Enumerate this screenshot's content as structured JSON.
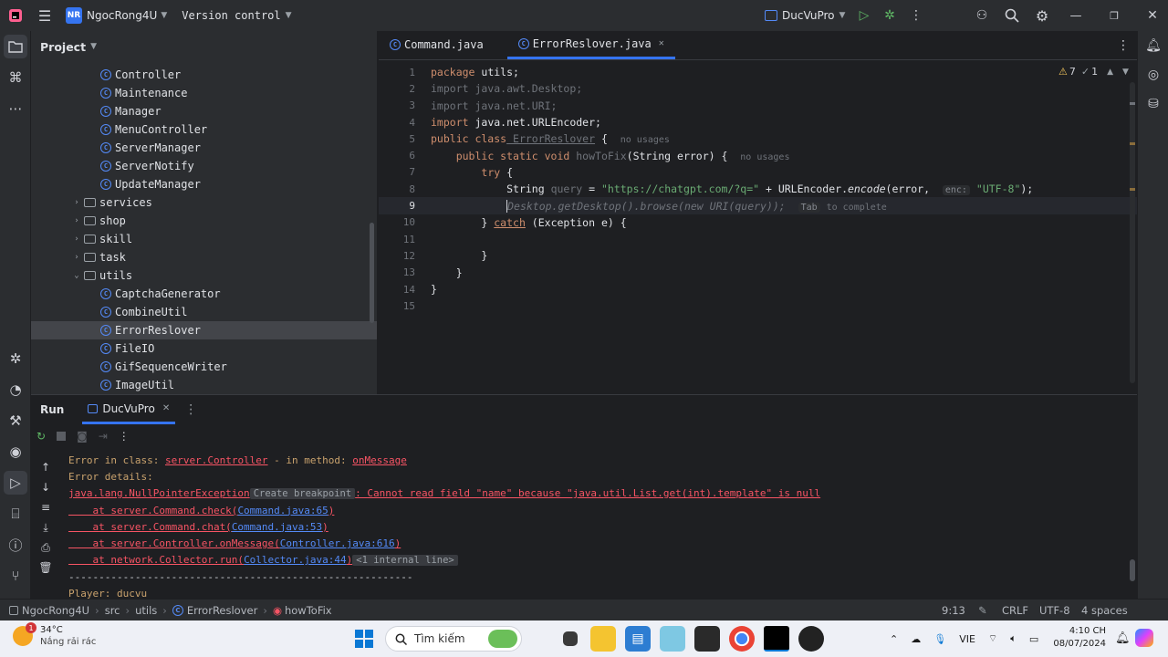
{
  "titlebar": {
    "project_badge": "NR",
    "project_name": "NgocRong4U",
    "vcs_label": "Version control",
    "run_config": "DucVuPro"
  },
  "project_panel": {
    "title": "Project",
    "items": [
      {
        "label": "Controller",
        "type": "class",
        "indent": 2
      },
      {
        "label": "Maintenance",
        "type": "class",
        "indent": 2
      },
      {
        "label": "Manager",
        "type": "class",
        "indent": 2
      },
      {
        "label": "MenuController",
        "type": "class",
        "indent": 2
      },
      {
        "label": "ServerManager",
        "type": "class",
        "indent": 2
      },
      {
        "label": "ServerNotify",
        "type": "class",
        "indent": 2
      },
      {
        "label": "UpdateManager",
        "type": "class",
        "indent": 2
      },
      {
        "label": "services",
        "type": "folder",
        "indent": 1
      },
      {
        "label": "shop",
        "type": "folder",
        "indent": 1
      },
      {
        "label": "skill",
        "type": "folder",
        "indent": 1
      },
      {
        "label": "task",
        "type": "folder",
        "indent": 1
      },
      {
        "label": "utils",
        "type": "folder-open",
        "indent": 1
      },
      {
        "label": "CaptchaGenerator",
        "type": "class",
        "indent": 2
      },
      {
        "label": "CombineUtil",
        "type": "class",
        "indent": 2
      },
      {
        "label": "ErrorReslover",
        "type": "class",
        "indent": 2,
        "selected": true
      },
      {
        "label": "FileIO",
        "type": "class",
        "indent": 2
      },
      {
        "label": "GifSequenceWriter",
        "type": "class",
        "indent": 2
      },
      {
        "label": "ImageUtil",
        "type": "class",
        "indent": 2
      }
    ]
  },
  "editor": {
    "tabs": [
      {
        "label": "Command.java",
        "active": false
      },
      {
        "label": "ErrorReslover.java",
        "active": true
      }
    ],
    "warnings": "7",
    "checks": "1",
    "lines": [
      "1",
      "2",
      "3",
      "4",
      "5",
      "6",
      "7",
      "8",
      "9",
      "10",
      "11",
      "12",
      "13",
      "14",
      "15"
    ],
    "code": {
      "l1_kw": "package",
      "l1_rest": " utils;",
      "l2": "import java.awt.Desktop;",
      "l3": "import java.net.URI;",
      "l4_kw": "import",
      "l4_rest": " java.net.URLEncoder;",
      "l5_kw": "public class",
      "l5_name": " ErrorReslover",
      "l5_brace": " {",
      "l5_hint": "no usages",
      "l6_kw": "public static void",
      "l6_name": " howToFix",
      "l6_rest": "(String error) {",
      "l6_hint": "no usages",
      "l7_kw": "try",
      "l7_rest": " {",
      "l8_a": "String ",
      "l8_var": "query",
      "l8_b": " = ",
      "l8_str": "\"https://chatgpt.com/?q=\"",
      "l8_c": " + URLEncoder.",
      "l8_fn": "encode",
      "l8_d": "(error, ",
      "l8_hint": "enc:",
      "l8_str2": "\"UTF-8\"",
      "l8_e": ");",
      "l9_ghost": "Desktop.getDesktop().browse(new URI(query));",
      "l9_hint_tab": "Tab",
      "l9_hint": "to complete",
      "l10_a": "} ",
      "l10_kw": "catch",
      "l10_b": " (Exception e) {",
      "l12": "}",
      "l13": "}",
      "l14": "}"
    }
  },
  "run_panel": {
    "title": "Run",
    "tab_label": "DucVuPro",
    "console": {
      "l1_a": "Error in class: ",
      "l1_link": "server.Controller",
      "l1_b": " - in method: ",
      "l1_link2": "onMessage",
      "l2": "Error details:",
      "l3_link": "java.lang.NullPointerException",
      "l3_box": "Create breakpoint",
      "l3_rest": ": Cannot read field \"name\" because \"java.util.List.get(int).template\" is null",
      "l4_a": "    at server.Command.check(",
      "l4_link": "Command.java:65",
      "l4_b": ")",
      "l5_a": "    at server.Command.chat(",
      "l5_link": "Command.java:53",
      "l5_b": ")",
      "l6_a": "    at server.Controller.onMessage(",
      "l6_link": "Controller.java:616",
      "l6_b": ")",
      "l7_a": "    at network.Collector.run(",
      "l7_link": "Collector.java:44",
      "l7_b": ")",
      "l7_box": "<1 internal line>",
      "l8": "---------------------------------------------------------",
      "l9": "Player: ducvu"
    }
  },
  "statusbar": {
    "crumbs": [
      "NgocRong4U",
      "src",
      "utils",
      "ErrorReslover",
      "howToFix"
    ],
    "position": "9:13",
    "line_sep": "CRLF",
    "encoding": "UTF-8",
    "indent": "4 spaces"
  },
  "taskbar": {
    "weather_temp": "34°C",
    "weather_desc": "Nắng rải rác",
    "weather_badge": "1",
    "search_placeholder": "Tìm kiếm",
    "lang": "VIE",
    "time": "4:10 CH",
    "date": "08/07/2024"
  }
}
